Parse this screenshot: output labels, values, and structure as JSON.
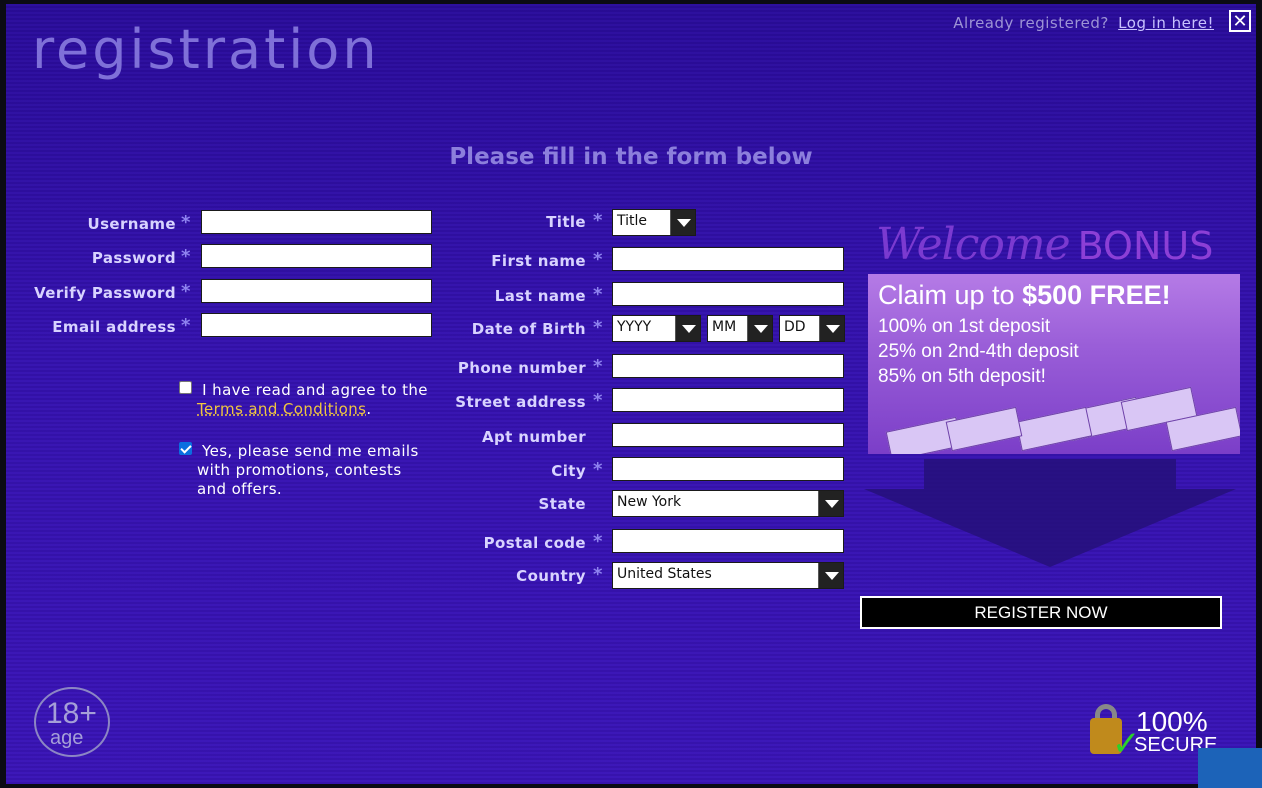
{
  "header": {
    "title": "registration",
    "already_text": "Already registered?",
    "login_link": "Log in here!",
    "close_icon": "close-icon"
  },
  "subtitle": "Please fill in the form below",
  "left_form": {
    "username_label": "Username",
    "password_label": "Password",
    "verify_password_label": "Verify Password",
    "email_label": "Email address",
    "required_mark": "*"
  },
  "agreements": {
    "terms_text": "I have read and agree to the",
    "terms_link": "Terms and Conditions",
    "terms_end": ".",
    "terms_checked": false,
    "promo_text": "Yes, please send me emails with promotions, contests and offers.",
    "promo_checked": true
  },
  "right_form": {
    "title_label": "Title",
    "title_value": "Title",
    "first_name_label": "First name",
    "last_name_label": "Last name",
    "dob_label": "Date of Birth",
    "dob_year": "YYYY",
    "dob_month": "MM",
    "dob_day": "DD",
    "phone_label": "Phone number",
    "street_label": "Street address",
    "apt_label": "Apt number",
    "city_label": "City",
    "state_label": "State",
    "state_value": "New York",
    "postal_label": "Postal code",
    "country_label": "Country",
    "country_value": "United States"
  },
  "bonus": {
    "welcome": "Welcome",
    "bonus_word": "BONUS",
    "claim_prefix": "Claim up to",
    "claim_amount": "$500 FREE!",
    "line1": "100% on 1st deposit",
    "line2": "25% on 2nd-4th deposit",
    "line3": "85% on 5th deposit!"
  },
  "register_button": "REGISTER NOW",
  "badges": {
    "age_num": "18+",
    "age_word": "age",
    "secure_pct": "100%",
    "secure_word": "SECURE"
  },
  "colors": {
    "background": "#3512b0",
    "accent_text": "#8c7fdc",
    "terms_link": "#f0c640",
    "button": "#000000"
  }
}
